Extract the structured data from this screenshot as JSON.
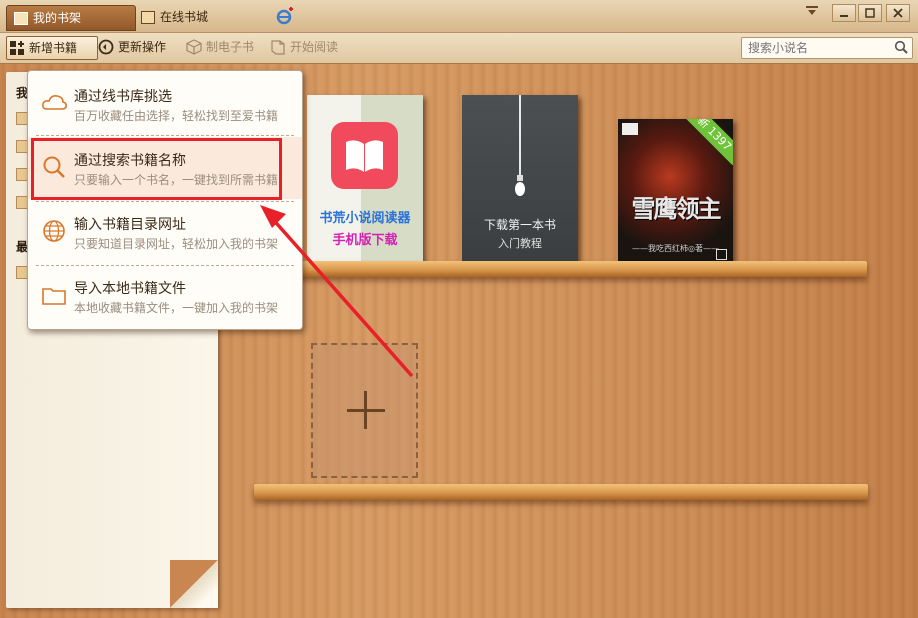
{
  "titlebar": {
    "tabs": [
      {
        "label": "我的书架",
        "active": true
      },
      {
        "label": "在线书城",
        "active": false
      }
    ]
  },
  "toolbar": {
    "add_book": "新增书籍",
    "more_actions": "更新操作",
    "make_ebook": "制电子书",
    "start_reading": "开始阅读",
    "search_placeholder": "搜索小说名"
  },
  "sidebar": {
    "labels": [
      "我",
      "最"
    ]
  },
  "dropdown": {
    "items": [
      {
        "title": "通过线书库挑选",
        "subtitle": "百万收藏任由选择，轻松找到至爱书籍",
        "icon": "cloud-icon"
      },
      {
        "title": "通过搜索书籍名称",
        "subtitle": "只要输入一个书名，一键找到所需书籍",
        "icon": "search-icon"
      },
      {
        "title": "输入书籍目录网址",
        "subtitle": "只要知道目录网址，轻松加入我的书架",
        "icon": "globe-icon"
      },
      {
        "title": "导入本地书籍文件",
        "subtitle": "本地收藏书籍文件，一键加入我的书架",
        "icon": "folder-icon"
      }
    ]
  },
  "books": [
    {
      "line1": "书荒小说阅读器",
      "line2": "手机版下载"
    },
    {
      "line1": "下载第一本书",
      "line2": "入门教程"
    },
    {
      "ribbon": "新 1397",
      "title": "雪鹰领主",
      "author": "——我吃西红柿◎著——"
    }
  ],
  "colors": {
    "highlight": "#e8202a",
    "accent_brown": "#92582a"
  }
}
